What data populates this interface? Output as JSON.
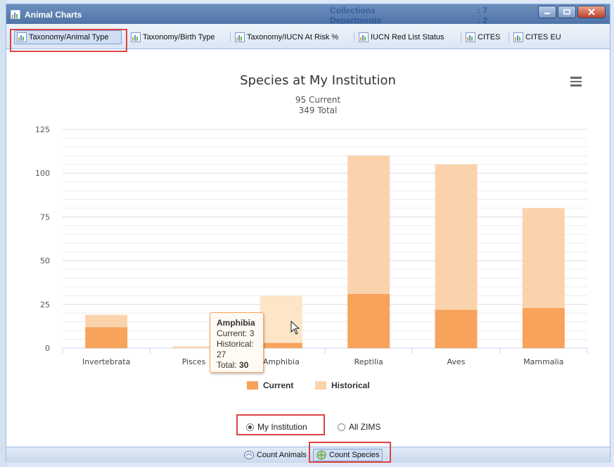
{
  "window": {
    "title": "Animal Charts",
    "bg_collections": "Collections",
    "bg_collections_val": ": 7",
    "bg_departments": "Departments",
    "bg_departments_val": ": 2"
  },
  "tabs": [
    {
      "label": "Taxonomy/Animal Type",
      "active": true
    },
    {
      "label": "Taxonomy/Birth Type",
      "active": false
    },
    {
      "label": "Taxonomy/IUCN At Risk %",
      "active": false
    },
    {
      "label": "IUCN Red List Status",
      "active": false
    },
    {
      "label": "CITES",
      "active": false
    },
    {
      "label": "CITES EU",
      "active": false
    }
  ],
  "chart_data": {
    "type": "bar",
    "stacked": true,
    "title": "Species at My Institution",
    "subtitle_lines": [
      "95 Current",
      "349 Total"
    ],
    "categories": [
      "Invertebrata",
      "Pisces",
      "Amphibia",
      "Reptilia",
      "Aves",
      "Mammalia"
    ],
    "series": [
      {
        "name": "Current",
        "values": [
          12,
          0,
          3,
          31,
          22,
          23
        ],
        "color": "#f7a35c"
      },
      {
        "name": "Historical",
        "values": [
          7,
          1,
          27,
          79,
          83,
          57
        ],
        "color": "#fad3ad"
      }
    ],
    "ylim": [
      0,
      125
    ],
    "yticks": [
      0,
      25,
      50,
      75,
      100,
      125
    ],
    "grid": true,
    "legend": "bottom-center",
    "hover_color": "#fde6c7"
  },
  "tooltip": {
    "category": "Amphibia",
    "current_label": "Current:",
    "current": "3",
    "historical_label": "Historical:",
    "historical": "27",
    "total_label": "Total:",
    "total": "30"
  },
  "radios": [
    {
      "label": "My Institution",
      "selected": true
    },
    {
      "label": "All ZIMS",
      "selected": false
    }
  ],
  "bottom": [
    {
      "label": "Count Animals",
      "active": false
    },
    {
      "label": "Count Species",
      "active": true
    }
  ],
  "colors": {
    "accent": "#99bbe8",
    "highlight": "#e04343",
    "titlebar": "#4f74a8"
  }
}
